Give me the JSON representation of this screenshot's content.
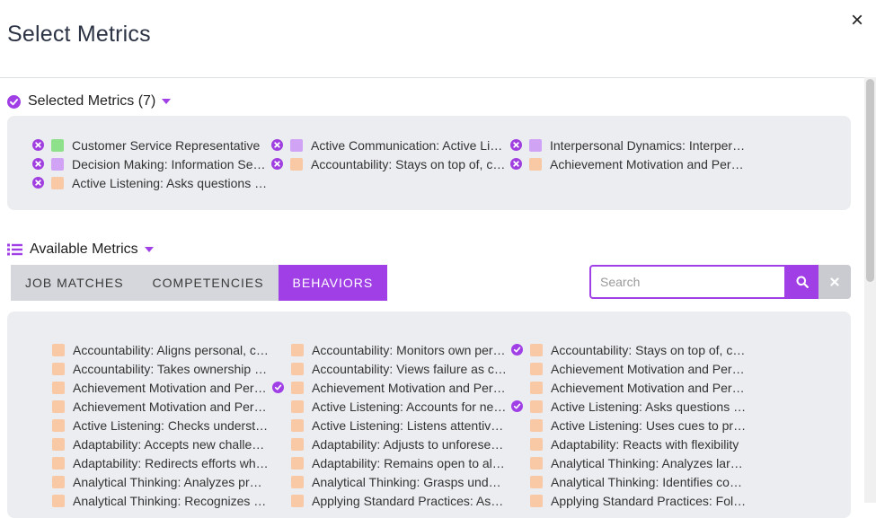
{
  "dialog": {
    "title": "Select Metrics",
    "close": "×"
  },
  "selected": {
    "heading": "Selected Metrics (7)",
    "items": [
      {
        "label": "Customer Service Representative",
        "color": "#8ee08a"
      },
      {
        "label": "Active Communication: Active Listen...",
        "color": "#d1a3f4"
      },
      {
        "label": "Interpersonal Dynamics: Interperson...",
        "color": "#d1a3f4"
      },
      {
        "label": "Decision Making: Information Seeking",
        "color": "#d1a3f4"
      },
      {
        "label": "Accountability: Stays on top of, close...",
        "color": "#f9c9a6"
      },
      {
        "label": "Achievement Motivation and Persev...",
        "color": "#f9c9a6"
      },
      {
        "label": "Active Listening: Asks questions to g...",
        "color": "#f9c9a6"
      }
    ]
  },
  "available": {
    "heading": "Available Metrics",
    "tabs": [
      {
        "label": "JOB MATCHES",
        "active": false
      },
      {
        "label": "COMPETENCIES",
        "active": false
      },
      {
        "label": "BEHAVIORS",
        "active": true
      }
    ],
    "search": {
      "placeholder": "Search",
      "value": ""
    },
    "swatch_color": "#f9c9a6",
    "accent_color": "#a03fe6",
    "items": [
      {
        "label": "Accountability: Aligns personal, com...",
        "checked": false
      },
      {
        "label": "Accountability: Monitors own perfor...",
        "checked": true
      },
      {
        "label": "Accountability: Stays on top of, close...",
        "checked": false
      },
      {
        "label": "Accountability: Takes ownership of o...",
        "checked": false
      },
      {
        "label": "Accountability: Views failure as chan...",
        "checked": false
      },
      {
        "label": "Achievement Motivation and Persev...",
        "checked": false
      },
      {
        "label": "Achievement Motivation and Persev...",
        "checked": true
      },
      {
        "label": "Achievement Motivation and Persev...",
        "checked": false
      },
      {
        "label": "Achievement Motivation and Persev...",
        "checked": false
      },
      {
        "label": "Achievement Motivation and Persev...",
        "checked": false
      },
      {
        "label": "Active Listening: Accounts for needs ...",
        "checked": true
      },
      {
        "label": "Active Listening: Asks questions to g...",
        "checked": false
      },
      {
        "label": "Active Listening: Checks understandi...",
        "checked": false
      },
      {
        "label": "Active Listening: Listens attentively t...",
        "checked": false
      },
      {
        "label": "Active Listening: Uses cues to promp...",
        "checked": false
      },
      {
        "label": "Adaptability: Accepts new challenges...",
        "checked": false
      },
      {
        "label": "Adaptability: Adjusts to unforeseen r...",
        "checked": false
      },
      {
        "label": "Adaptability: Reacts with flexibility",
        "checked": false
      },
      {
        "label": "Adaptability: Redirects efforts when ...",
        "checked": false
      },
      {
        "label": "Adaptability: Remains open to altern...",
        "checked": false
      },
      {
        "label": "Analytical Thinking: Analyzes large a...",
        "checked": false
      },
      {
        "label": "Analytical Thinking: Analyzes proble...",
        "checked": false
      },
      {
        "label": "Analytical Thinking: Grasps underlyi...",
        "checked": false
      },
      {
        "label": "Analytical Thinking: Identifies conne...",
        "checked": false
      },
      {
        "label": "Analytical Thinking: Recognizes prob...",
        "checked": false
      },
      {
        "label": "Applying Standard Practices: Asks m...",
        "checked": false
      },
      {
        "label": "Applying Standard Practices: Follows ...",
        "checked": false
      }
    ]
  }
}
